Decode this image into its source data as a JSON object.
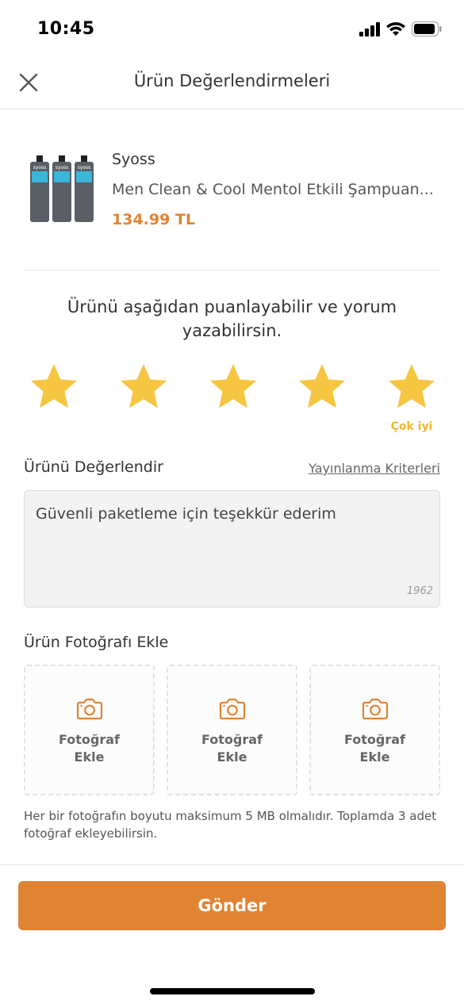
{
  "status_bar": {
    "time": "10:45"
  },
  "header": {
    "title": "Ürün Değerlendirmeleri",
    "close_icon": "close-icon"
  },
  "product": {
    "brand": "Syoss",
    "name": "Men Clean & Cool Mentol Etkili Şampuan...",
    "price": "134.99 TL"
  },
  "rating": {
    "prompt_line1": "Ürünü aşağıdan puanlayabilir ve yorum",
    "prompt_line2": "yazabilirsin.",
    "value": 5,
    "max": 5,
    "label": "Çok iyi",
    "star_color": "#f6c542"
  },
  "review": {
    "section_title": "Ürünü Değerlendir",
    "criteria_link": "Yayınlanma Kriterleri",
    "text": "Güvenli paketleme için teşekkür ederim",
    "remaining_chars": "1962"
  },
  "photos": {
    "section_title": "Ürün Fotoğrafı Ekle",
    "slots": [
      {
        "line1": "Fotoğraf",
        "line2": "Ekle"
      },
      {
        "line1": "Fotoğraf",
        "line2": "Ekle"
      },
      {
        "line1": "Fotoğraf",
        "line2": "Ekle"
      }
    ],
    "note": "Her bir fotoğrafın boyutu maksimum 5 MB olmalıdır. Toplamda 3 adet fotoğraf ekleyebilirsin."
  },
  "submit_label": "Gönder",
  "colors": {
    "accent": "#e08434",
    "star": "#f6c542",
    "rating_label": "#f0b82a"
  }
}
